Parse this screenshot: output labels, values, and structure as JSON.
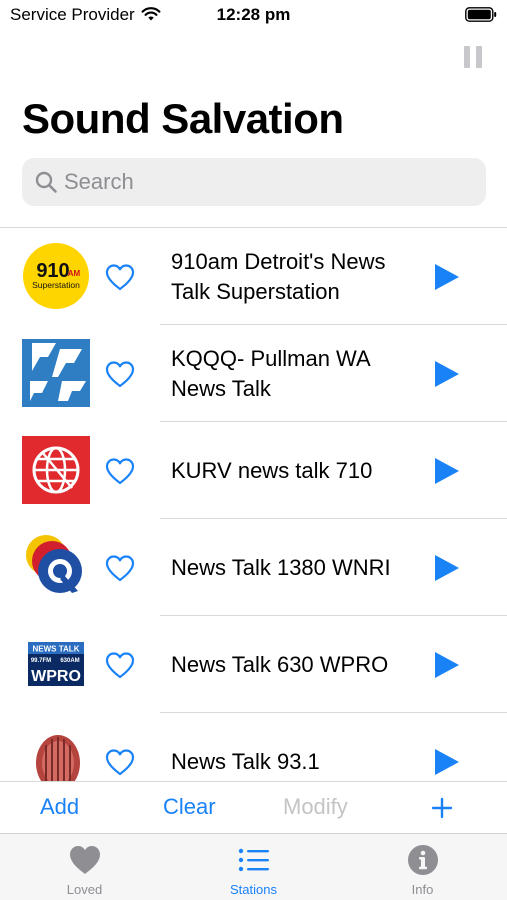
{
  "status_bar": {
    "carrier": "Service Provider",
    "time": "12:28 pm"
  },
  "header": {
    "title": "Sound Salvation"
  },
  "search": {
    "placeholder": "Search"
  },
  "stations": [
    {
      "name": "910am Detroit's News Talk Superstation",
      "logo": "910am-superstation-logo",
      "loved": false
    },
    {
      "name": "KQQQ- Pullman WA News Talk",
      "logo": "kqqq-logo",
      "loved": false
    },
    {
      "name": "KURV news talk 710",
      "logo": "kurv-globe-logo",
      "loved": false
    },
    {
      "name": "News Talk 1380 WNRI",
      "logo": "wnri-q-logo",
      "loved": false
    },
    {
      "name": "News Talk 630 WPRO",
      "logo": "wpro-logo",
      "loved": false
    },
    {
      "name": "News Talk 93.1",
      "logo": "microphone-logo",
      "loved": false
    }
  ],
  "logo_text": {
    "s910_main": "910",
    "s910_am": "AM",
    "s910_sub": "Superstation",
    "wpro_top": "NEWS TALK",
    "wpro_freq1": "99.7FM",
    "wpro_freq2": "630AM",
    "wpro_call": "WPRO"
  },
  "actions": {
    "add": "Add",
    "clear": "Clear",
    "modify": "Modify"
  },
  "tabs": [
    {
      "label": "Loved",
      "icon": "heart-fill-icon",
      "active": false
    },
    {
      "label": "Stations",
      "icon": "list-icon",
      "active": true
    },
    {
      "label": "Info",
      "icon": "info-circle-icon",
      "active": false
    }
  ],
  "colors": {
    "accent": "#1a82f7",
    "disabled": "#c4c4c6",
    "tab_inactive": "#8e8e93"
  }
}
